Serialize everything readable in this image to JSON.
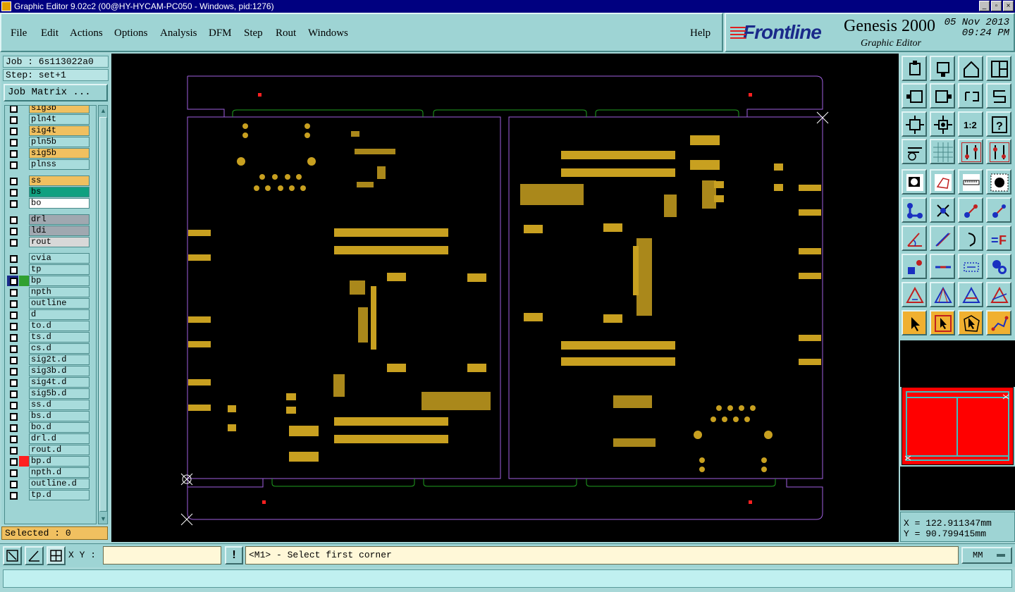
{
  "window": {
    "title": "Graphic Editor 9.02c2 (00@HY-HYCAM-PC050 - Windows, pid:1276)"
  },
  "menu": {
    "items": [
      {
        "id": "file",
        "label": "File"
      },
      {
        "id": "edit",
        "label": "Edit"
      },
      {
        "id": "actions",
        "label": "Actions"
      },
      {
        "id": "options",
        "label": "Options"
      },
      {
        "id": "analysis",
        "label": "Analysis"
      },
      {
        "id": "dfm",
        "label": "DFM"
      },
      {
        "id": "step",
        "label": "Step"
      },
      {
        "id": "rout",
        "label": "Rout"
      },
      {
        "id": "windows",
        "label": "Windows"
      }
    ],
    "help": "Help"
  },
  "brand": {
    "logo": "Frontline",
    "product": "Genesis 2000",
    "subtitle": "Graphic Editor",
    "date": "05 Nov 2013",
    "time": "09:24 PM"
  },
  "job": {
    "job_label": "Job : 6s113022a0",
    "step_label": "Step: set+1",
    "matrix_button": "Job Matrix ..."
  },
  "layers": [
    {
      "name": "sig3b",
      "color": "#f0c060",
      "swatch": ""
    },
    {
      "name": "pln4t",
      "color": "#a8dcdc",
      "swatch": ""
    },
    {
      "name": "sig4t",
      "color": "#f0c060",
      "swatch": ""
    },
    {
      "name": "pln5b",
      "color": "#a8dcdc",
      "swatch": ""
    },
    {
      "name": "sig5b",
      "color": "#f0c060",
      "swatch": ""
    },
    {
      "name": "plnss",
      "color": "#a8dcdc",
      "swatch": ""
    },
    {
      "name": "ss",
      "color": "#f0c060",
      "swatch": ""
    },
    {
      "name": "bs",
      "color": "#10a080",
      "swatch": ""
    },
    {
      "name": "bo",
      "color": "#ffffff",
      "swatch": ""
    },
    {
      "name": "drl",
      "color": "#a0a8b0",
      "swatch": ""
    },
    {
      "name": "ldi",
      "color": "#a0a8b0",
      "swatch": ""
    },
    {
      "name": "rout",
      "color": "#d8d8d8",
      "swatch": ""
    },
    {
      "name": "cvia",
      "color": "#a8dcdc",
      "swatch": ""
    },
    {
      "name": "tp",
      "color": "#a8dcdc",
      "swatch": ""
    },
    {
      "name": "bp",
      "color": "#a8dcdc",
      "swatch": "#30a030"
    },
    {
      "name": "npth",
      "color": "#a8dcdc",
      "swatch": ""
    },
    {
      "name": "outline",
      "color": "#a8dcdc",
      "swatch": ""
    },
    {
      "name": "d",
      "color": "#a8dcdc",
      "swatch": ""
    },
    {
      "name": "to.d",
      "color": "#a8dcdc",
      "swatch": ""
    },
    {
      "name": "ts.d",
      "color": "#a8dcdc",
      "swatch": ""
    },
    {
      "name": "cs.d",
      "color": "#a8dcdc",
      "swatch": ""
    },
    {
      "name": "sig2t.d",
      "color": "#a8dcdc",
      "swatch": ""
    },
    {
      "name": "sig3b.d",
      "color": "#a8dcdc",
      "swatch": ""
    },
    {
      "name": "sig4t.d",
      "color": "#a8dcdc",
      "swatch": ""
    },
    {
      "name": "sig5b.d",
      "color": "#a8dcdc",
      "swatch": ""
    },
    {
      "name": "ss.d",
      "color": "#a8dcdc",
      "swatch": ""
    },
    {
      "name": "bs.d",
      "color": "#a8dcdc",
      "swatch": ""
    },
    {
      "name": "bo.d",
      "color": "#a8dcdc",
      "swatch": ""
    },
    {
      "name": "drl.d",
      "color": "#a8dcdc",
      "swatch": ""
    },
    {
      "name": "rout.d",
      "color": "#a8dcdc",
      "swatch": ""
    },
    {
      "name": "bp.d",
      "color": "#a8dcdc",
      "swatch": "#ff2020"
    },
    {
      "name": "npth.d",
      "color": "#a8dcdc",
      "swatch": ""
    },
    {
      "name": "outline.d",
      "color": "#a8dcdc",
      "swatch": ""
    },
    {
      "name": "tp.d",
      "color": "#a8dcdc",
      "swatch": ""
    }
  ],
  "selected": "Selected : 0",
  "coords": {
    "x": "X = 122.911347mm",
    "y": "Y = 90.799415mm"
  },
  "bottom": {
    "xy_label": "X Y :",
    "xy_value": "",
    "bang": "!",
    "prompt": "<M1> - Select first corner",
    "units": "MM"
  },
  "colors": {
    "pad": "#c8a020",
    "outline": "#a060e0",
    "rout": "#20a020",
    "marker": "#ff0000",
    "canvas": "#000000"
  }
}
